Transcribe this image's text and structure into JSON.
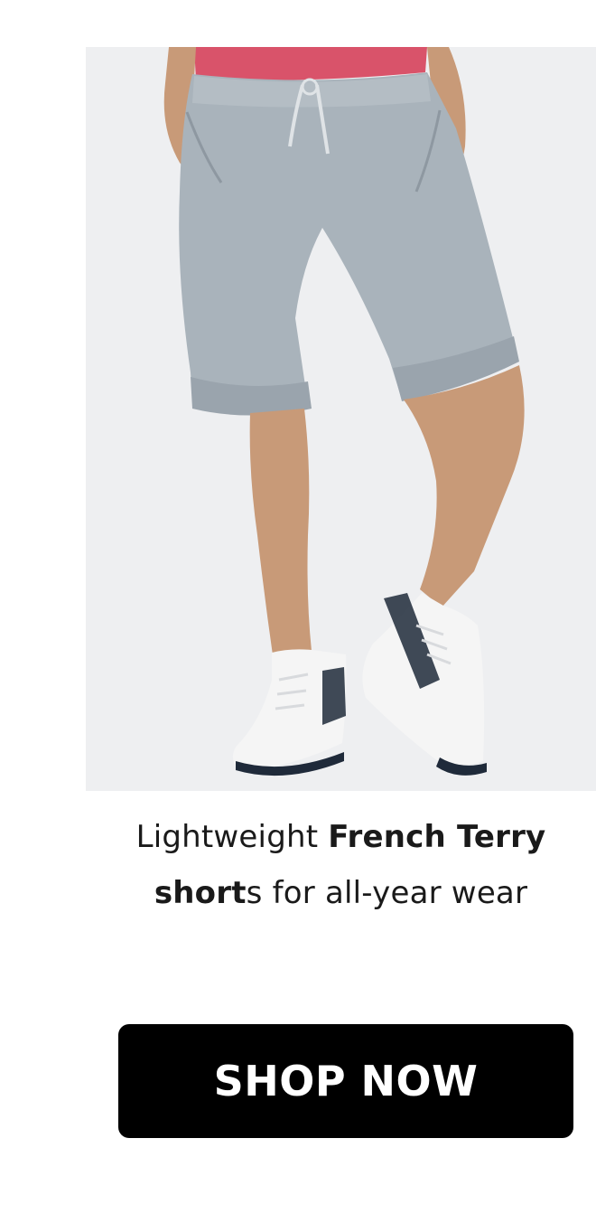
{
  "product_image": {
    "subject": "gray french terry shorts with drawstring, white high-top sneakers",
    "colors": {
      "background": "#eeeff1",
      "shorts": "#a9b3bb",
      "top": "#d9536a",
      "skin": "#c89a78",
      "sneaker": "#f5f5f5",
      "sneaker_accent": "#1f2a3a"
    }
  },
  "caption": {
    "line1_regular": "Lightweight ",
    "line1_bold": "French Terry",
    "line2_bold": "short",
    "line2_regular": "s for all-year wear"
  },
  "cta": {
    "label": "SHOP NOW",
    "background": "#000000",
    "text_color": "#ffffff"
  }
}
